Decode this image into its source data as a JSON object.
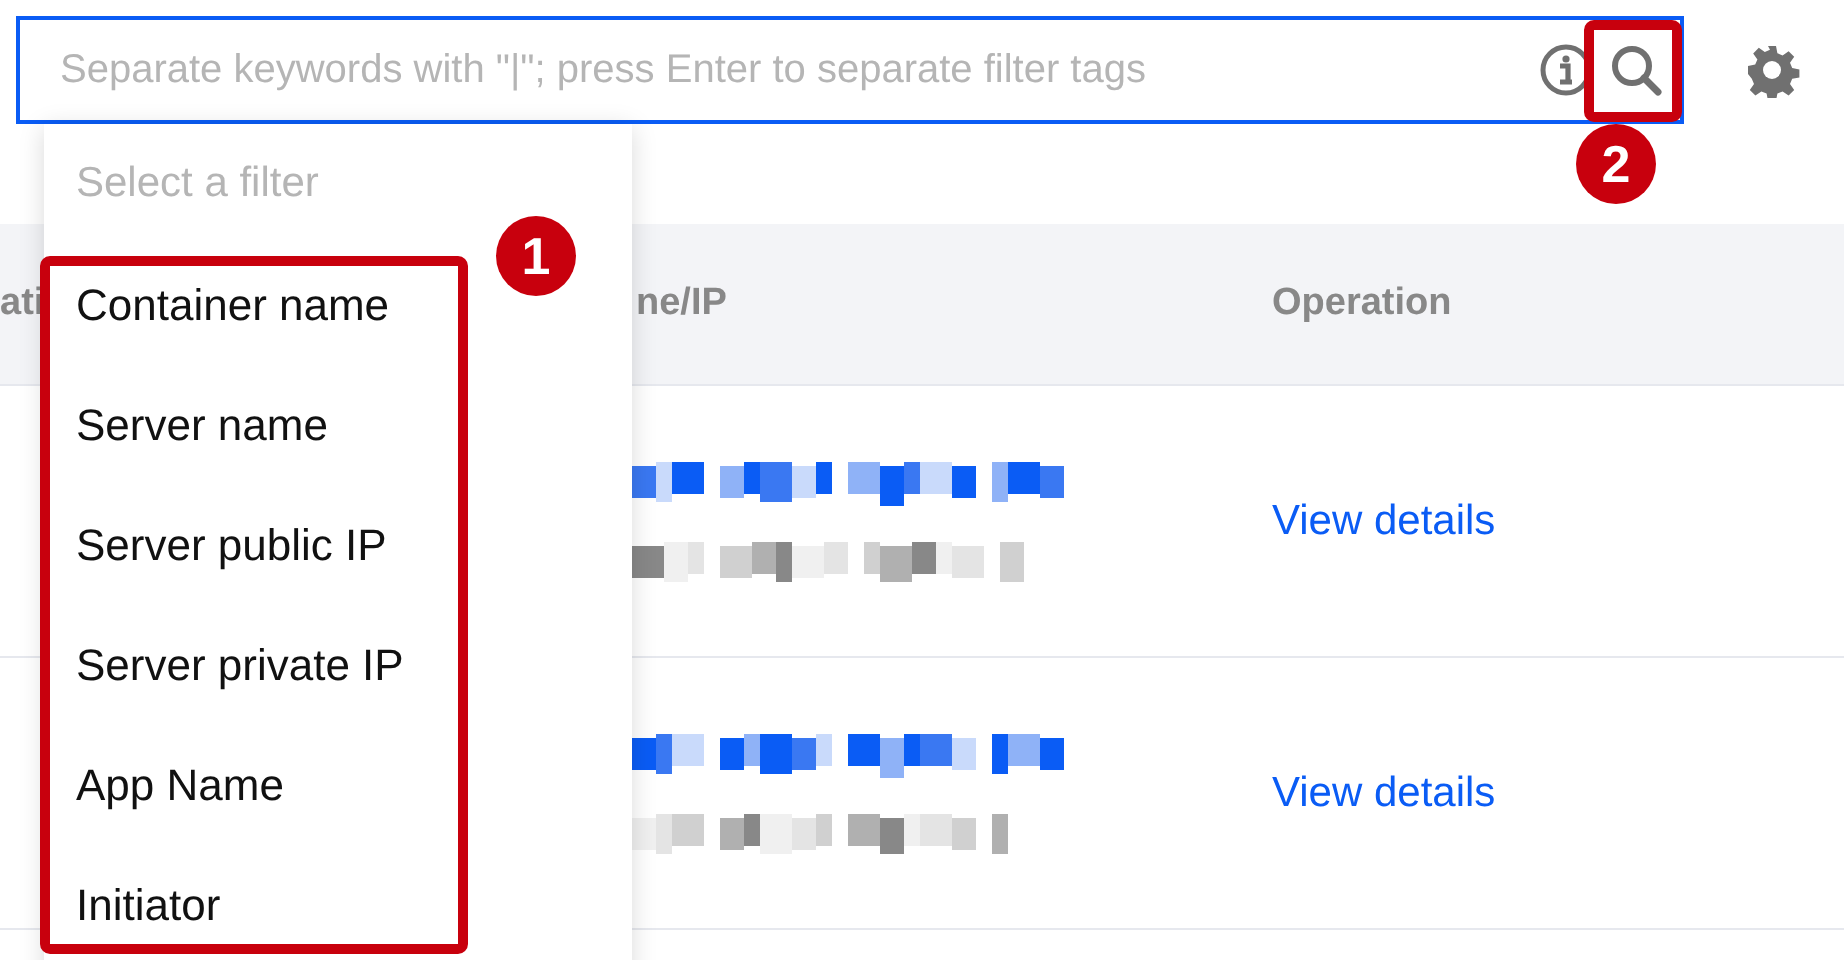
{
  "search": {
    "placeholder": "Separate keywords with \"|\"; press Enter to separate filter tags"
  },
  "table": {
    "columns": [
      "ati",
      "ne/IP",
      "Operation"
    ],
    "rows": [
      {
        "operation": "View details"
      },
      {
        "operation": "View details"
      }
    ]
  },
  "filter_menu": {
    "title": "Select a filter",
    "items": [
      "Container name",
      "Server name",
      "Server public IP",
      "Server private IP",
      "App Name",
      "Initiator"
    ]
  },
  "annotations": [
    {
      "label": "1"
    },
    {
      "label": "2"
    }
  ]
}
